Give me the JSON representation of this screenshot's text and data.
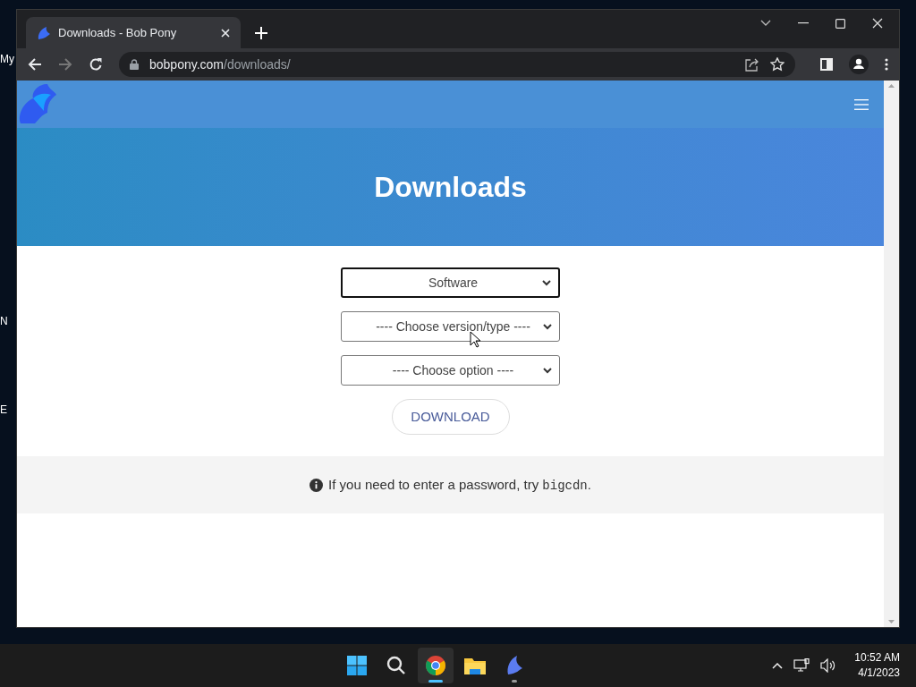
{
  "desktop": {
    "icon_labels": [
      "My",
      "N",
      "E"
    ]
  },
  "browser": {
    "tabs": [
      {
        "title": "Downloads - Bob Pony",
        "selected": true
      }
    ],
    "address": {
      "domain": "bobpony.com",
      "path": "/downloads/"
    }
  },
  "page": {
    "title": "Downloads",
    "selects": [
      {
        "value": "Software",
        "focused": true
      },
      {
        "value": "---- Choose version/type ----",
        "focused": false
      },
      {
        "value": "---- Choose option ----",
        "focused": false
      }
    ],
    "button": "DOWNLOAD",
    "note": {
      "text": "If you need to enter a password, try ",
      "code": "bigcdn",
      "end": "."
    }
  },
  "taskbar": {
    "items": [
      {
        "kind": "start",
        "open": false,
        "selected": false
      },
      {
        "kind": "search",
        "open": false,
        "selected": false
      },
      {
        "kind": "browser",
        "open": true,
        "selected": true
      },
      {
        "kind": "folder",
        "open": false,
        "selected": false
      },
      {
        "kind": "app",
        "open": true,
        "selected": false
      }
    ],
    "time": "10:52 AM",
    "date": "4/1/2023"
  }
}
